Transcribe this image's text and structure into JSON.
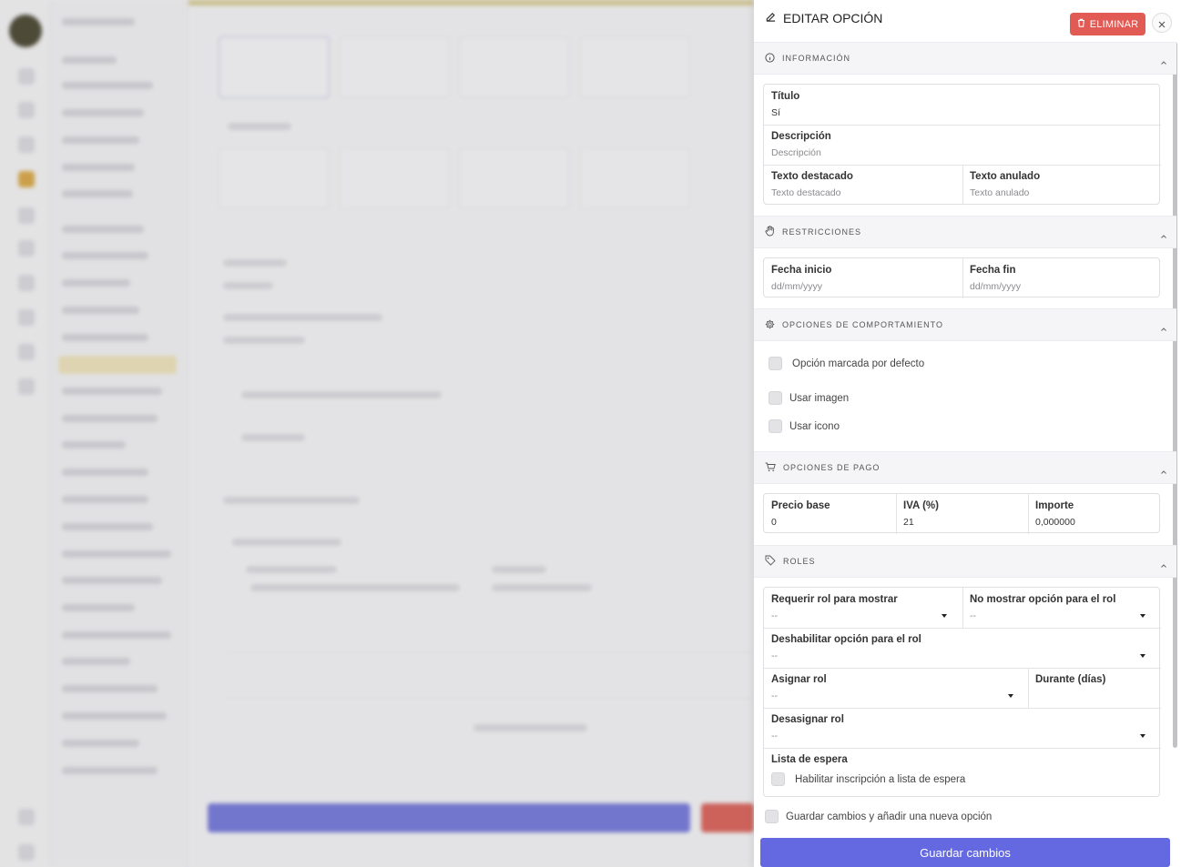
{
  "panel": {
    "title": "EDITAR OPCIÓN",
    "delete_label": "ELIMINAR",
    "close_icon": "close-icon"
  },
  "sections": {
    "info": {
      "title": "INFORMACIÓN",
      "titulo": {
        "label": "Título",
        "value": "Sí"
      },
      "descripcion": {
        "label": "Descripción",
        "placeholder": "Descripción"
      },
      "texto_destacado": {
        "label": "Texto destacado",
        "placeholder": "Texto destacado"
      },
      "texto_anulado": {
        "label": "Texto anulado",
        "placeholder": "Texto anulado"
      }
    },
    "restricciones": {
      "title": "RESTRICCIONES",
      "fecha_inicio": {
        "label": "Fecha inicio",
        "placeholder": "dd/mm/yyyy"
      },
      "fecha_fin": {
        "label": "Fecha fin",
        "placeholder": "dd/mm/yyyy"
      }
    },
    "comportamiento": {
      "title": "OPCIONES DE COMPORTAMIENTO",
      "checks": [
        "Opción marcada por defecto",
        "Usar imagen",
        "Usar icono"
      ]
    },
    "pago": {
      "title": "OPCIONES DE PAGO",
      "precio_base": {
        "label": "Precio base",
        "value": "0"
      },
      "iva": {
        "label": "IVA (%)",
        "value": "21"
      },
      "importe": {
        "label": "Importe",
        "value": "0,000000"
      }
    },
    "roles": {
      "title": "ROLES",
      "requerir": {
        "label": "Requerir rol para mostrar",
        "value": "--"
      },
      "no_mostrar": {
        "label": "No mostrar opción para el rol",
        "value": "--"
      },
      "deshabilitar": {
        "label": "Deshabilitar opción para el rol",
        "value": "--"
      },
      "asignar": {
        "label": "Asignar rol",
        "value": "--"
      },
      "durante": {
        "label": "Durante (días)",
        "value": ""
      },
      "desasignar": {
        "label": "Desasignar rol",
        "value": "--"
      },
      "lista_espera": {
        "label": "Lista de espera",
        "check": "Habilitar inscripción a lista de espera"
      }
    }
  },
  "footer": {
    "save_and_new": "Guardar cambios y añadir una nueva opción",
    "save_label": "Guardar cambios"
  },
  "colors": {
    "primary": "#6469e2",
    "danger": "#e25a54"
  }
}
